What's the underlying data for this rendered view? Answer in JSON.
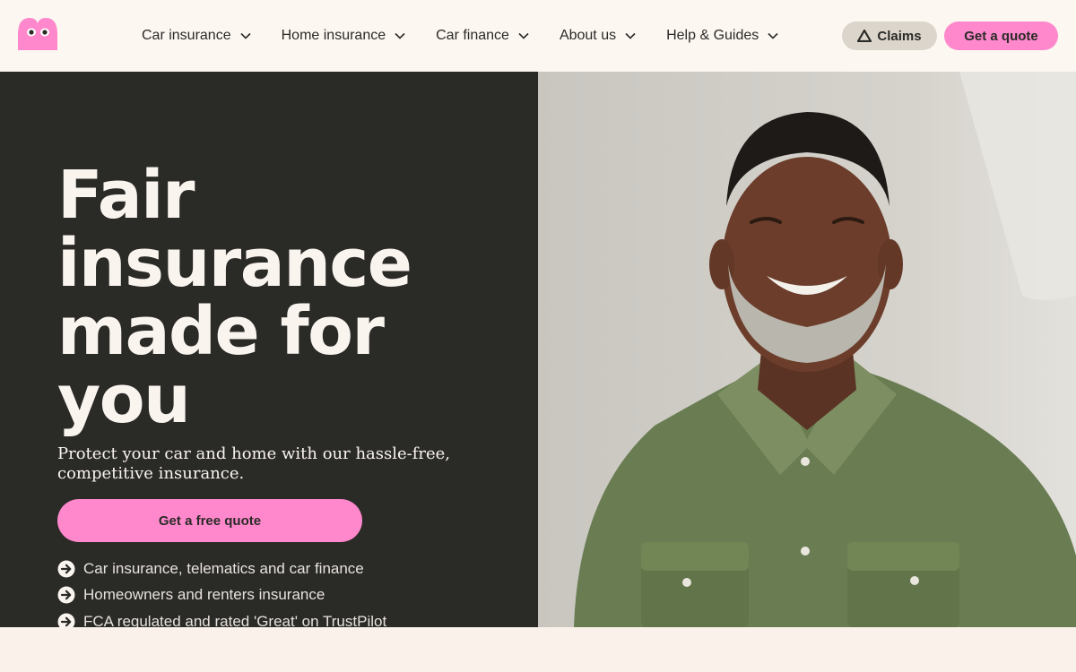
{
  "brand": {
    "logo_icon": "ghost-eyes-logo",
    "accent_color": "#ff88cc",
    "dark_color": "#2a2a27",
    "cream_color": "#faf4ef"
  },
  "nav": {
    "items": [
      {
        "label": "Car insurance"
      },
      {
        "label": "Home insurance"
      },
      {
        "label": "Car finance"
      },
      {
        "label": "About us"
      },
      {
        "label": "Help & Guides"
      }
    ]
  },
  "header": {
    "claims_label": "Claims",
    "quote_label": "Get a quote"
  },
  "hero": {
    "title": "Fair insurance made for you",
    "subtitle": "Protect your car and home with our hassle-free, competitive insurance.",
    "cta_label": "Get a free quote",
    "features": [
      "Car insurance, telematics and car finance",
      "Homeowners and renters insurance",
      "FCA regulated and rated 'Great' on TrustPilot"
    ],
    "image": "smiling-man-green-shirt-photo"
  }
}
